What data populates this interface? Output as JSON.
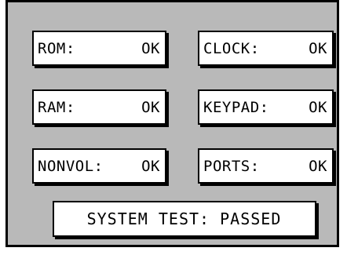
{
  "tests": [
    {
      "label": "ROM:",
      "status": "OK"
    },
    {
      "label": "CLOCK:",
      "status": "OK"
    },
    {
      "label": "RAM:",
      "status": "OK"
    },
    {
      "label": "KEYPAD:",
      "status": "OK"
    },
    {
      "label": "NONVOL:",
      "status": "OK"
    },
    {
      "label": "PORTS:",
      "status": "OK"
    }
  ],
  "summary": {
    "label": "SYSTEM TEST:",
    "status": "PASSED"
  },
  "colors": {
    "background": "#c8c8c8",
    "panel": "#ffffff",
    "border": "#000000"
  }
}
